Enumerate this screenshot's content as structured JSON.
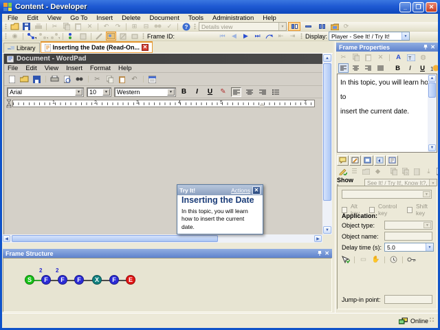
{
  "window": {
    "title": "Content - Developer"
  },
  "menubar": {
    "items": [
      "File",
      "Edit",
      "View",
      "Go To",
      "Insert",
      "Delete",
      "Document",
      "Tools",
      "Administration",
      "Help"
    ]
  },
  "toolbars": {
    "details_view": "Details view",
    "frame_id_label": "Frame ID:",
    "display_label": "Display:",
    "display_value": "Player - See It! / Try It!"
  },
  "tabs": {
    "library_label": "Library",
    "topic_label": "Inserting the Date (Read-On..."
  },
  "wordpad": {
    "title": "Document - WordPad",
    "menu_items": [
      "File",
      "Edit",
      "View",
      "Insert",
      "Format",
      "Help"
    ],
    "font_name": "Arial",
    "font_size": "10",
    "script_value": "Western",
    "ruler_numbers": [
      "1",
      "2",
      "3",
      "4",
      "5",
      "7"
    ]
  },
  "tryit_popup": {
    "header": "Try It!",
    "actions_link": "Actions",
    "title": "Inserting the Date",
    "body": "In this topic, you will learn how to insert the current date."
  },
  "frame_properties": {
    "title": "Frame Properties",
    "bubble_text_line1": "In this topic, you will learn how to",
    "bubble_text_line2": "insert the current date.",
    "show_in_label": "Show in:",
    "show_in_value": "See It! / Try It!, Know It?, Do It!",
    "alt_key_label": "Alt key",
    "control_key_label": "Control key",
    "shift_key_label": "Shift key",
    "application_label": "Application:",
    "object_type_label": "Object type:",
    "object_name_label": "Object name:",
    "delay_time_label": "Delay time (s):",
    "delay_time_value": "5.0",
    "jump_in_label": "Jump-in point:"
  },
  "frame_structure": {
    "title": "Frame Structure",
    "nodes": [
      {
        "label": "S",
        "color": "#17c217",
        "sup": ""
      },
      {
        "label": "F",
        "color": "#2b2bd5",
        "sup": "2"
      },
      {
        "label": "F",
        "color": "#2b2bd5",
        "sup": "2"
      },
      {
        "label": "F",
        "color": "#2b2bd5",
        "sup": ""
      },
      {
        "label": "X",
        "color": "#11807f",
        "sup": ""
      },
      {
        "label": "F",
        "color": "#2b2bd5",
        "sup": ""
      },
      {
        "label": "E",
        "color": "#e21414",
        "sup": ""
      }
    ]
  },
  "statusbar": {
    "online_label": "Online"
  }
}
